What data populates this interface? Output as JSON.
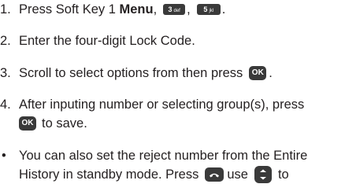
{
  "steps": [
    {
      "num": "1.",
      "before": "Press Soft Key 1 ",
      "menu": "Menu",
      "sep1": ",",
      "key3": {
        "digit": "3",
        "letters": "def"
      },
      "sep2": ",",
      "key5": {
        "digit": "5",
        "letters": "jkl"
      },
      "end": "."
    },
    {
      "num": "2.",
      "text": "Enter the four-digit Lock Code."
    },
    {
      "num": "3.",
      "text": "Scroll to select options from then press",
      "ok": "OK",
      "end": "."
    },
    {
      "num": "4.",
      "line1": "After inputing number or selecting group(s), press",
      "ok": "OK",
      "line2": "to save."
    }
  ],
  "bullet": {
    "mark": "•",
    "line1": "You can also set the reject number from the Entire",
    "line2_a": "History in standby mode. Press",
    "line2_b": "use",
    "line2_c": "to"
  },
  "icons": {
    "send_key": "phone-send-icon",
    "nav_key": "navigation-key-icon",
    "ok_key": "ok-key-icon"
  },
  "colors": {
    "text": "#231f20",
    "key_bg": "#3a3a3a",
    "key_fg": "#ffffff"
  }
}
